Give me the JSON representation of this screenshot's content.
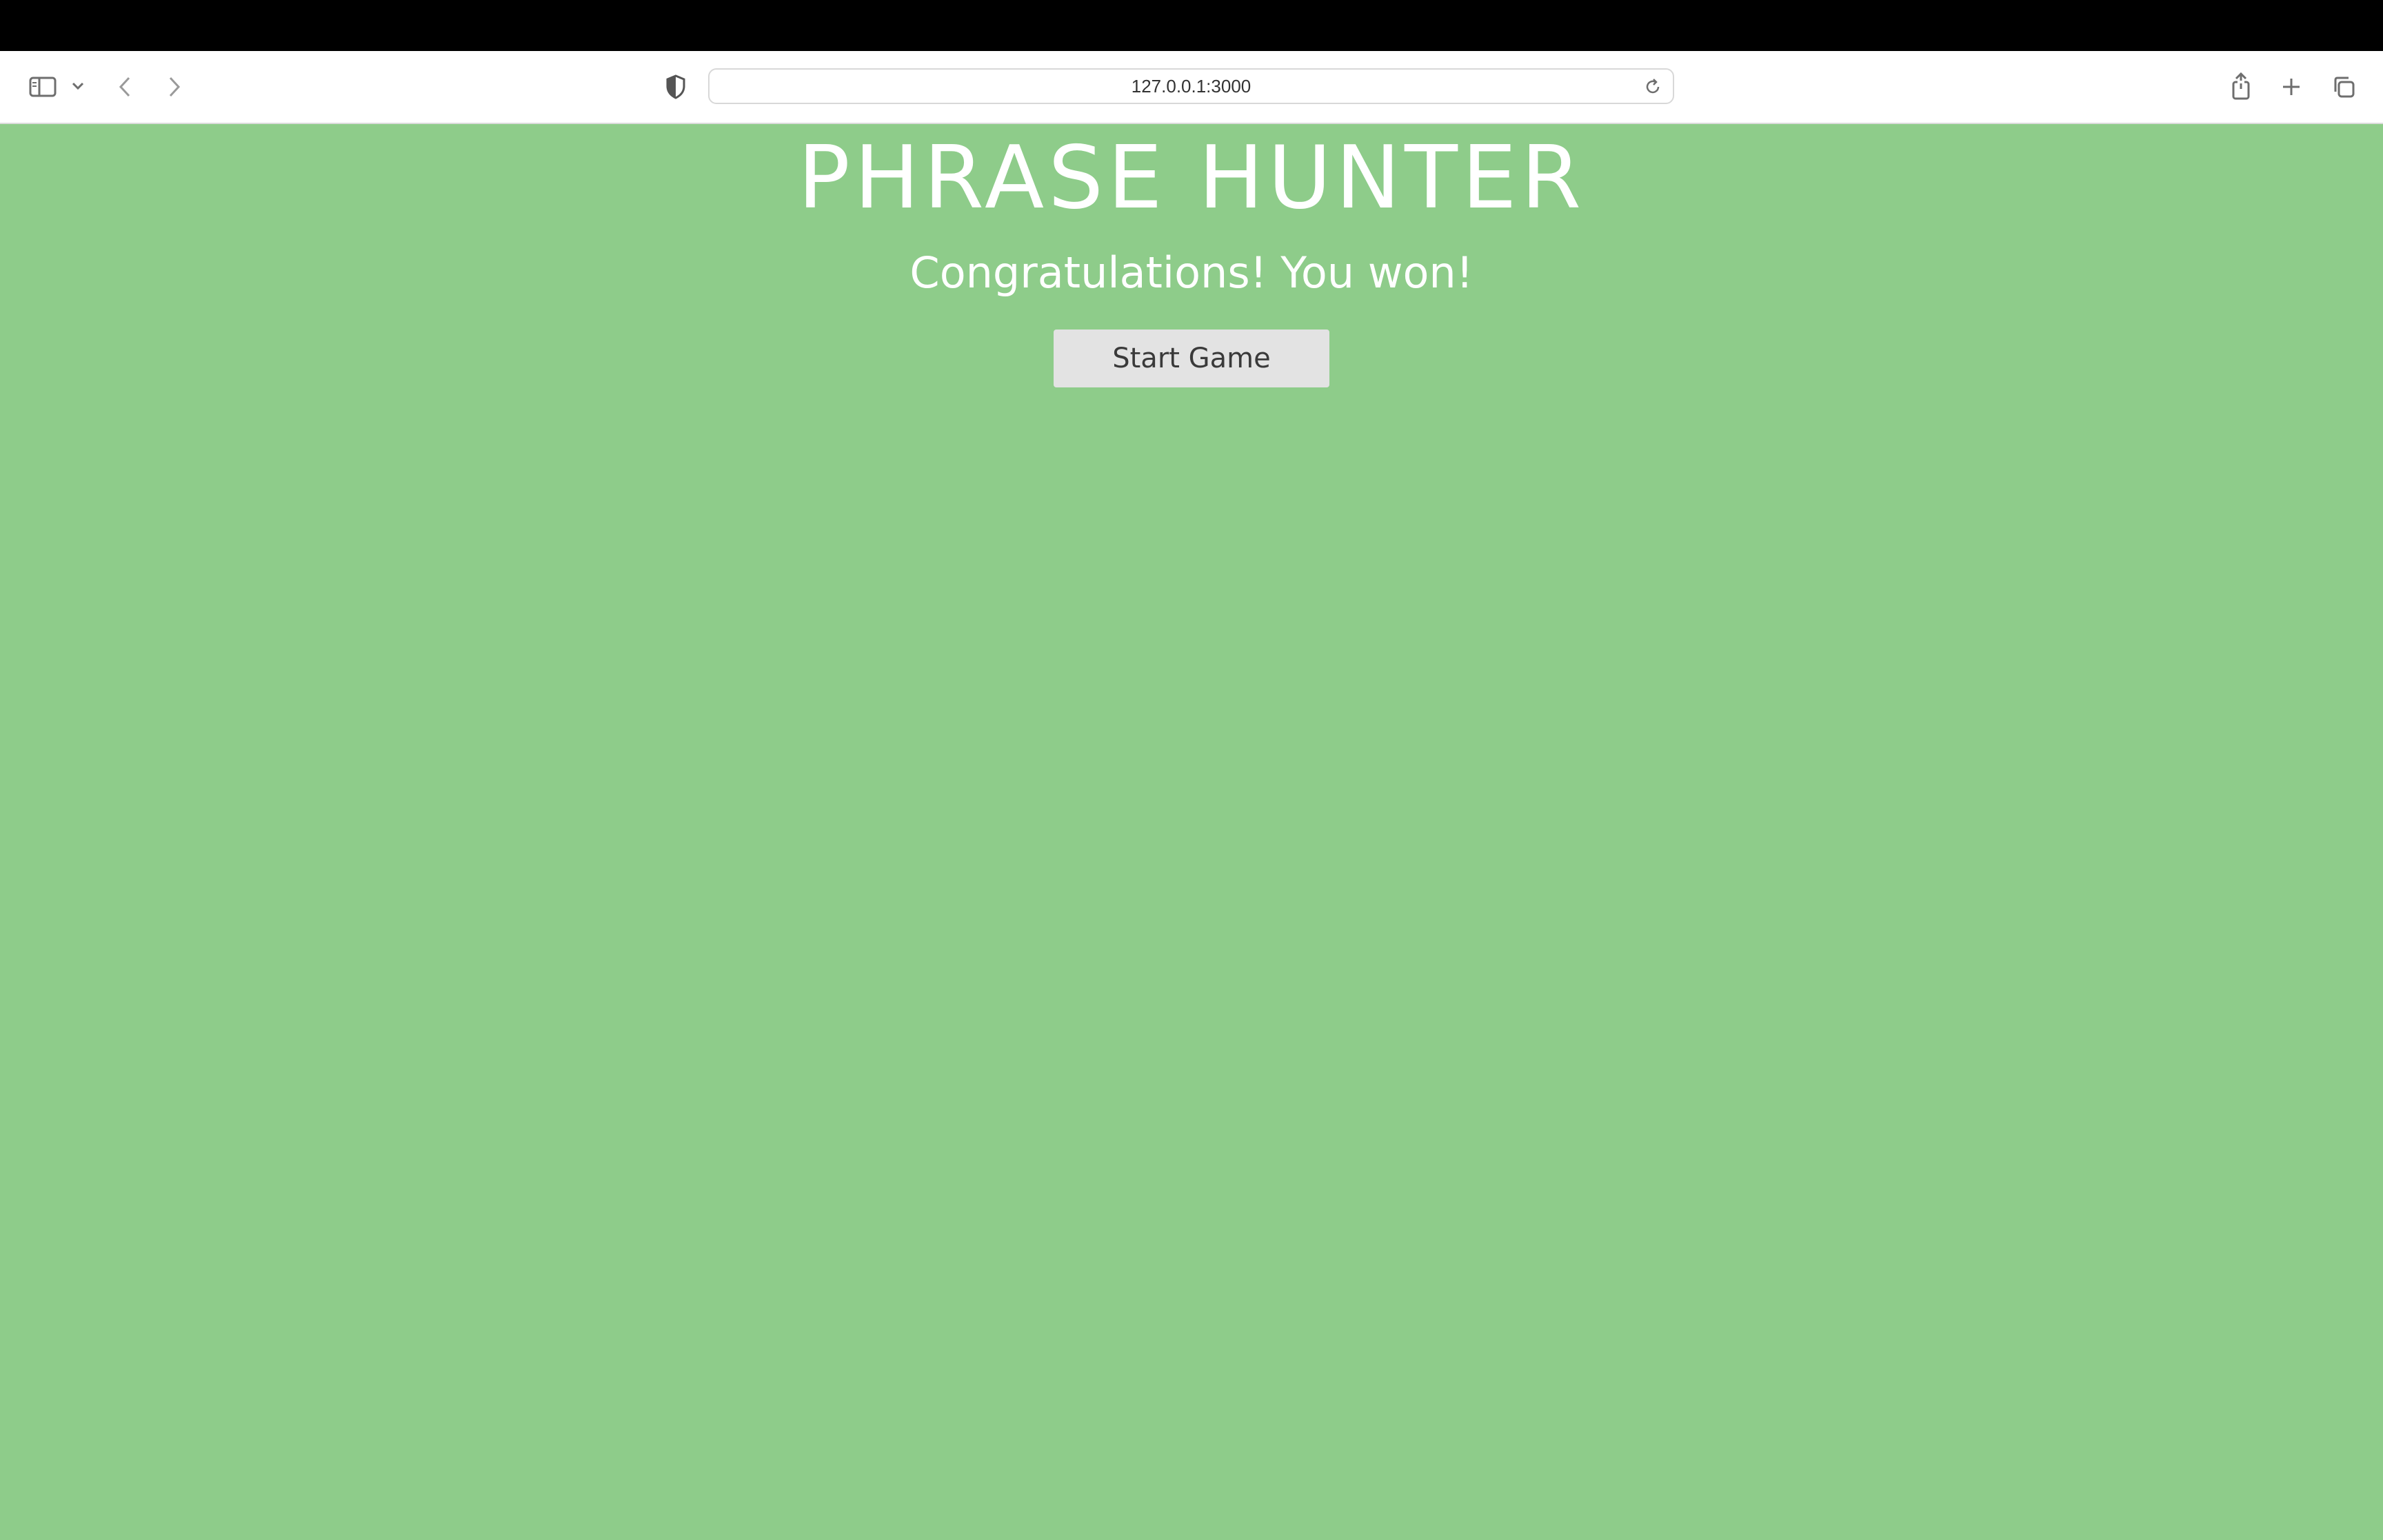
{
  "browser": {
    "url": "127.0.0.1:3000",
    "icons": [
      "sidebar-icon",
      "chevron-down-icon",
      "back-arrow-icon",
      "forward-arrow-icon",
      "privacy-shield-icon",
      "reload-icon",
      "share-icon",
      "new-tab-icon",
      "tab-overview-icon"
    ]
  },
  "game": {
    "title": "PHRASE HUNTER",
    "message": "Congratulations! You won!",
    "start_button_label": "Start Game",
    "background_color": "#8ecc8a"
  }
}
